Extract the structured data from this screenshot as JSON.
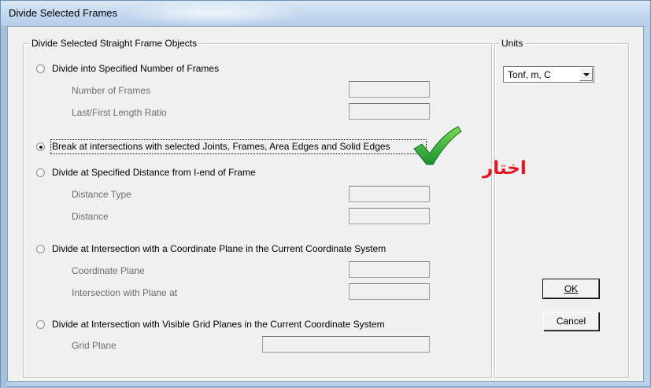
{
  "window": {
    "title": "Divide Selected Frames"
  },
  "main_group": {
    "title": "Divide Selected Straight Frame Objects",
    "options": [
      {
        "label": "Divide into Specified Number of Frames",
        "checked": false,
        "fields": [
          {
            "label": "Number of Frames",
            "value": ""
          },
          {
            "label": "Last/First Length Ratio",
            "value": ""
          }
        ]
      },
      {
        "label": "Break at intersections with selected Joints, Frames, Area Edges and Solid Edges",
        "checked": true,
        "fields": []
      },
      {
        "label": "Divide at Specified Distance from I-end of Frame",
        "checked": false,
        "fields": [
          {
            "label": "Distance Type",
            "value": ""
          },
          {
            "label": "Distance",
            "value": ""
          }
        ]
      },
      {
        "label": "Divide at Intersection with a Coordinate Plane in the Current Coordinate System",
        "checked": false,
        "fields": [
          {
            "label": "Coordinate Plane",
            "value": ""
          },
          {
            "label": "Intersection with Plane at",
            "value": ""
          }
        ]
      },
      {
        "label": "Divide at Intersection with Visible Grid Planes in the Current Coordinate System",
        "checked": false,
        "fields": [
          {
            "label": "Grid Plane",
            "value": ""
          }
        ]
      }
    ]
  },
  "units_group": {
    "title": "Units",
    "selected": "Tonf, m, C"
  },
  "buttons": {
    "ok": "OK",
    "cancel": "Cancel"
  },
  "annotation": {
    "text": "اختار",
    "color": "#e0171e",
    "check_color": "#22a83a"
  }
}
